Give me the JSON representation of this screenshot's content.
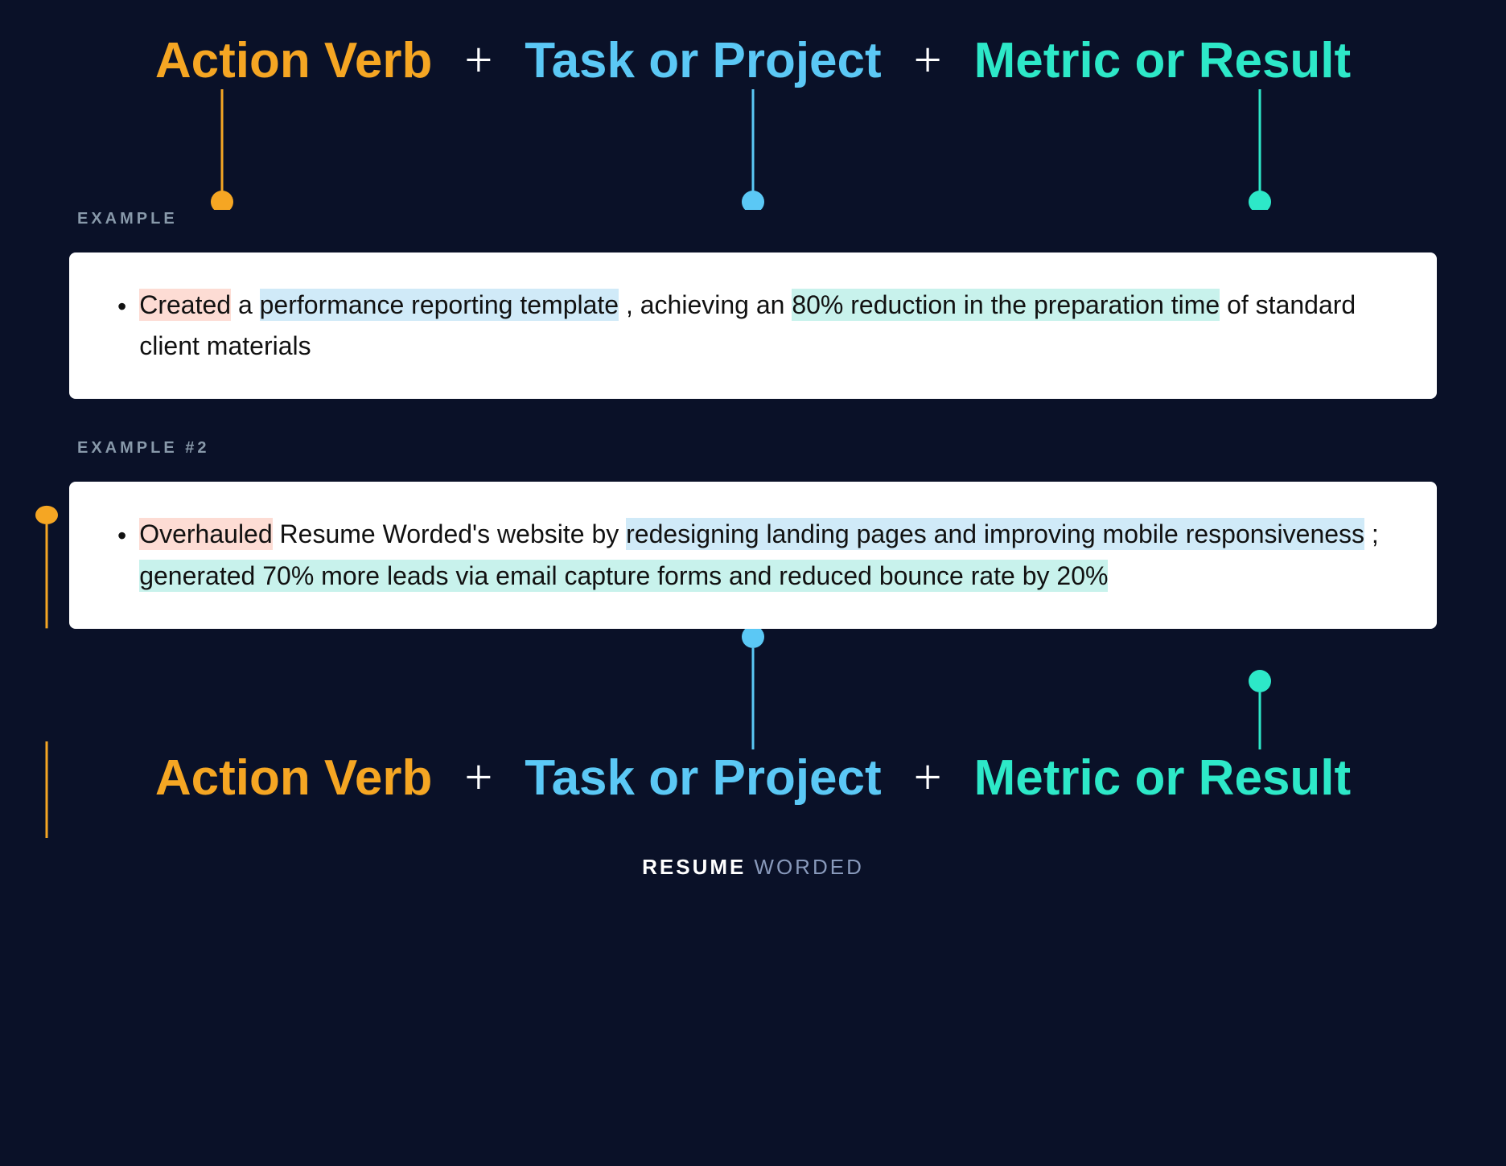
{
  "header": {
    "action_verb_label": "Action Verb",
    "task_project_label": "Task or Project",
    "metric_result_label": "Metric or Result",
    "plus_sign": "+",
    "colors": {
      "orange": "#f5a623",
      "blue": "#5bc8f5",
      "teal": "#2de8c8",
      "background": "#0a1128",
      "white": "#ffffff"
    }
  },
  "example1": {
    "label": "EXAMPLE",
    "text_parts": [
      {
        "text": "Created",
        "highlight": "orange"
      },
      {
        "text": " a ",
        "highlight": "none"
      },
      {
        "text": "performance reporting template",
        "highlight": "blue"
      },
      {
        "text": ", achieving an ",
        "highlight": "none"
      },
      {
        "text": "80% reduction in the preparation time",
        "highlight": "teal"
      },
      {
        "text": " of standard client materials",
        "highlight": "none"
      }
    ]
  },
  "example2": {
    "label": "EXAMPLE #2",
    "text_parts": [
      {
        "text": "Overhauled",
        "highlight": "orange"
      },
      {
        "text": " Resume Worded's website by ",
        "highlight": "none"
      },
      {
        "text": "redesigning landing pages and improving mobile responsiveness",
        "highlight": "blue"
      },
      {
        "text": "; ",
        "highlight": "none"
      },
      {
        "text": "generated 70% more leads via email capture forms and reduced bounce rate by 20%",
        "highlight": "teal"
      }
    ]
  },
  "footer": {
    "brand_resume": "RESUME",
    "brand_worded": "WORDED"
  }
}
